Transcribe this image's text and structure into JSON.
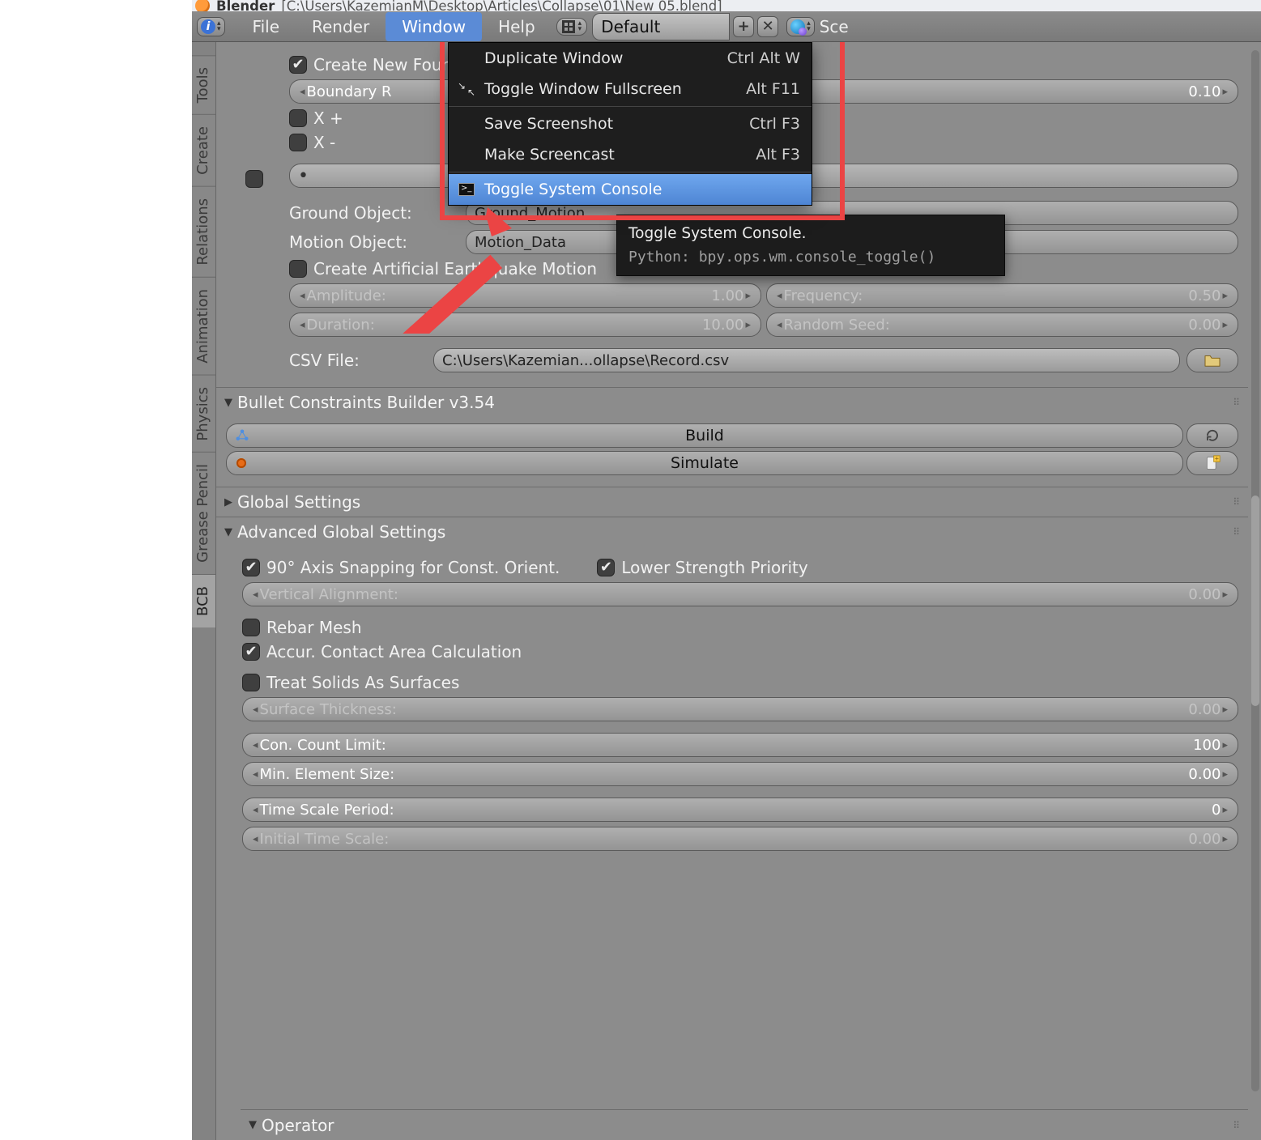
{
  "title": {
    "app": "Blender",
    "path": "[C:\\Users\\KazemianM\\Desktop\\Articles\\Collapse\\01\\New 05.blend]"
  },
  "top_menu": {
    "items": [
      "File",
      "Render",
      "Window",
      "Help"
    ],
    "active": "Window",
    "layout_label": "Default",
    "scene_label": "Sce"
  },
  "window_menu": {
    "items": [
      {
        "label": "Duplicate Window",
        "shortcut": "Ctrl Alt W",
        "icon": ""
      },
      {
        "label": "Toggle Window Fullscreen",
        "shortcut": "Alt F11",
        "icon": "fullscreen"
      },
      {
        "sep": true
      },
      {
        "label": "Save Screenshot",
        "shortcut": "Ctrl F3",
        "icon": ""
      },
      {
        "label": "Make Screencast",
        "shortcut": "Alt F3",
        "icon": ""
      },
      {
        "sep": true
      },
      {
        "label": "Toggle System Console",
        "shortcut": "",
        "icon": "console",
        "highlight": true
      }
    ]
  },
  "tooltip": {
    "title": "Toggle System Console.",
    "python": "Python: bpy.ops.wm.console_toggle()"
  },
  "side_tabs": [
    "Tools",
    "Create",
    "Relations",
    "Animation",
    "Physics",
    "Grease Pencil",
    "BCB"
  ],
  "active_side_tab": "BCB",
  "earthquake": {
    "create_label": "Create New Foundation Objects",
    "boundary": {
      "label": "Boundary R",
      "value": "0.10"
    },
    "axes": {
      "xplus": "X +",
      "xminus": "X -"
    },
    "ground_label": "Ground Object:",
    "ground_value": "Ground_Motion",
    "motion_label": "Motion Object:",
    "motion_value": "Motion_Data",
    "artificial_label": "Create Artificial Earthquake Motion",
    "amplitude": {
      "label": "Amplitude:",
      "value": "1.00"
    },
    "frequency": {
      "label": "Frequency:",
      "value": "0.50"
    },
    "duration": {
      "label": "Duration:",
      "value": "10.00"
    },
    "random_seed": {
      "label": "Random Seed:",
      "value": "0.00"
    },
    "csv_label": "CSV File:",
    "csv_value": "C:\\Users\\Kazemian...ollapse\\Record.csv"
  },
  "bcb_panel": {
    "title": "Bullet Constraints Builder v3.54",
    "build": "Build",
    "simulate": "Simulate"
  },
  "global": {
    "title": "Global Settings"
  },
  "advanced": {
    "title": "Advanced Global Settings",
    "axis_snap": "90° Axis Snapping for Const. Orient.",
    "lower_strength": "Lower Strength Priority",
    "vertical_alignment": {
      "label": "Vertical Alignment:",
      "value": "0.00"
    },
    "rebar": "Rebar Mesh",
    "accur": "Accur. Contact Area Calculation",
    "solids": "Treat Solids As Surfaces",
    "surface_thickness": {
      "label": "Surface Thickness:",
      "value": "0.00"
    },
    "con_count": {
      "label": "Con. Count Limit:",
      "value": "100"
    },
    "min_element": {
      "label": "Min. Element Size:",
      "value": "0.00"
    },
    "time_scale_period": {
      "label": "Time Scale Period:",
      "value": "0"
    },
    "initial_time_scale": {
      "label": "Initial Time Scale:",
      "value": "0.00"
    }
  },
  "operator": {
    "title": "Operator"
  }
}
